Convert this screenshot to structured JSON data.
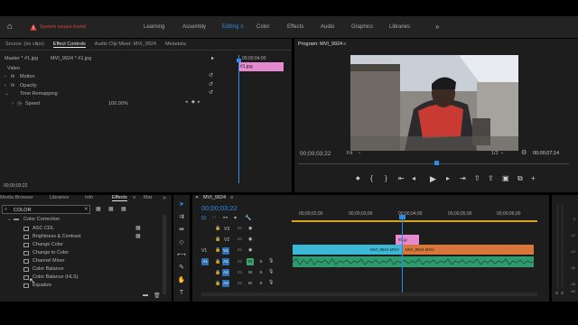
{
  "topbar": {
    "alert_text": "System issues found",
    "tabs": [
      "Learning",
      "Assembly",
      "Editing",
      "Color",
      "Effects",
      "Audio",
      "Graphics",
      "Libraries"
    ],
    "active_tab": "Editing",
    "more": "»"
  },
  "source_panel": {
    "tabs": [
      "Source: (no clips)",
      "Effect Controls",
      "Audio Clip Mixer: MVI_9924",
      "Metadata"
    ],
    "active_tab": "Effect Controls",
    "master_label": "Master * #1.jpg",
    "sequence_label": "MVI_9924 * #1.jpg",
    "timecode_header": "00;00;04;00",
    "clip_label": "#1.jpg",
    "rows": {
      "video": "Video",
      "motion": "Motion",
      "opacity": "Opacity",
      "time_remapping": "Time Remapping",
      "speed": "Speed",
      "speed_value": "100.00%",
      "fx": "fx"
    },
    "footer_timecode": "00;00;03;22"
  },
  "program_panel": {
    "title": "Program: MVI_9924",
    "timecode": "00;00;03;22",
    "fit": "Fit",
    "ratio": "1/2",
    "duration": "00;00;07;14"
  },
  "project_panel": {
    "tabs": [
      "Media Browser",
      "Libraries",
      "Info",
      "Effects",
      "Mar"
    ],
    "active_tab": "Effects",
    "search_value": "COLOR",
    "folder": "Color Correction",
    "items": [
      "ASC CDL",
      "Brightness & Contrast",
      "Change Color",
      "Change to Color",
      "Channel Mixer",
      "Color Balance",
      "Color Balance (HLS)",
      "Equalize"
    ]
  },
  "timeline": {
    "title": "MVI_9924",
    "timecode": "00;00;03;22",
    "ruler": [
      "00;00;02;00",
      "00;00;03;00",
      "00;00;04;00",
      "00;00;05;00",
      "00;00;06;00"
    ],
    "tracks": [
      "V3",
      "V2",
      "V1",
      "A1",
      "A2",
      "A3"
    ],
    "source_patch_v": "V1",
    "source_patch_a": "A1",
    "clip_v2": "#1.jp",
    "clip_v1a": "MVI_9924.MOV",
    "clip_v1b": "MVI_9924.MOV",
    "mute": "M",
    "solo": "S"
  },
  "audio_meter": {
    "ticks": [
      "0",
      "-12",
      "-24",
      "-36",
      "-48",
      "dB"
    ],
    "solo_buttons": [
      "S",
      "S"
    ]
  },
  "colors": {
    "accent": "#2d8ceb",
    "clip_video": "#3bb8d6",
    "clip_orange": "#d9773a",
    "clip_pink": "#e58ad0",
    "audio_green": "#2f9a6d",
    "alert": "#e04141"
  }
}
